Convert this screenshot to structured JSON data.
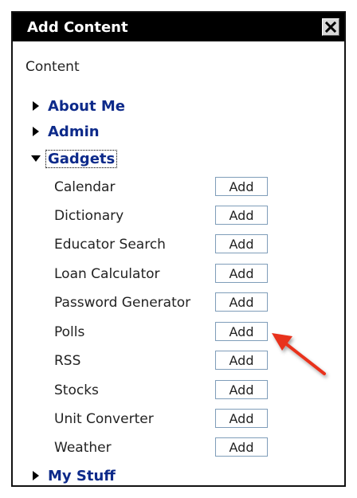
{
  "dialog": {
    "title": "Add Content",
    "close_icon": "close-x-icon"
  },
  "content_label": "Content",
  "categories": [
    {
      "label": "About Me",
      "expanded": false
    },
    {
      "label": "Admin",
      "expanded": false
    },
    {
      "label": "Gadgets",
      "expanded": true
    },
    {
      "label": "My Stuff",
      "expanded": false
    }
  ],
  "gadgets": [
    {
      "name": "Calendar",
      "button": "Add"
    },
    {
      "name": "Dictionary",
      "button": "Add"
    },
    {
      "name": "Educator Search",
      "button": "Add"
    },
    {
      "name": "Loan Calculator",
      "button": "Add"
    },
    {
      "name": "Password Generator",
      "button": "Add"
    },
    {
      "name": "Polls",
      "button": "Add"
    },
    {
      "name": "RSS",
      "button": "Add"
    },
    {
      "name": "Stocks",
      "button": "Add"
    },
    {
      "name": "Unit Converter",
      "button": "Add"
    },
    {
      "name": "Weather",
      "button": "Add"
    }
  ],
  "colors": {
    "titlebar": "#000000",
    "category_link": "#0d2a8a",
    "button_border": "#7f9db9",
    "annotation_arrow": "#e8321e"
  }
}
